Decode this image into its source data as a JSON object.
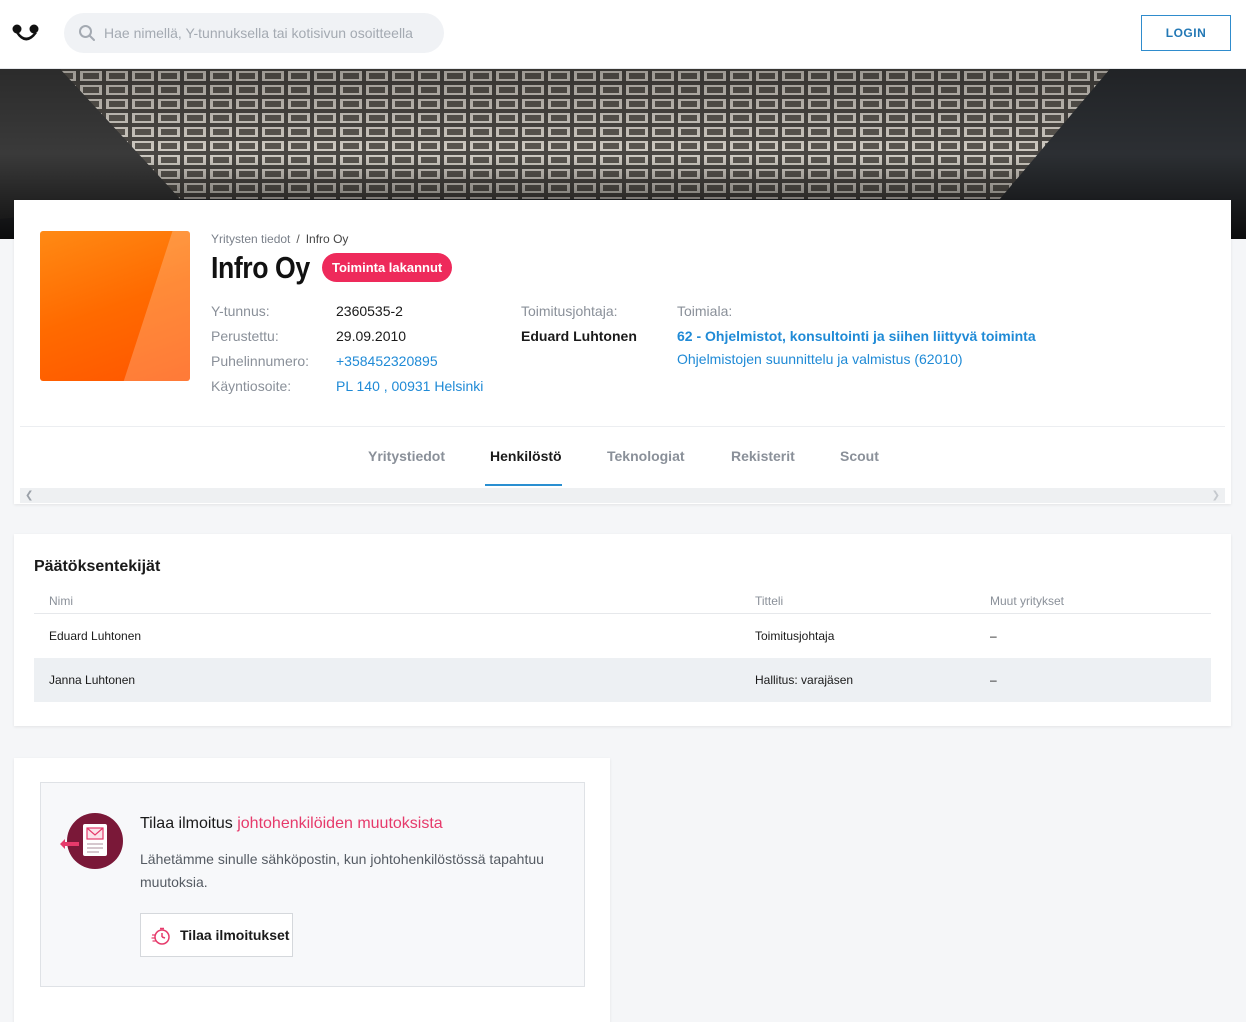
{
  "header": {
    "search_placeholder": "Hae nimellä, Y-tunnuksella tai kotisivun osoitteella",
    "login_label": "LOGIN"
  },
  "company": {
    "breadcrumb_root": "Yritysten tiedot",
    "breadcrumb_sep": "/",
    "breadcrumb_current": "Infro Oy",
    "name": "Infro Oy",
    "status": "Toiminta lakannut",
    "fields": {
      "ytunnus_label": "Y-tunnus:",
      "ytunnus_value": "2360535-2",
      "founded_label": "Perustettu:",
      "founded_value": "29.09.2010",
      "phone_label": "Puhelinnumero:",
      "phone_value": "+358452320895",
      "address_label": "Käyntiosoite:",
      "address_value": "PL 140 , 00931 Helsinki",
      "ceo_label": "Toimitusjohtaja:",
      "ceo_value": "Eduard Luhtonen",
      "industry_label": "Toimiala:",
      "industry_value": "62 - Ohjelmistot, konsultointi ja siihen liittyvä toiminta",
      "industry_sub": "Ohjelmistojen suunnittelu ja valmistus (62010)"
    }
  },
  "tabs": [
    {
      "label": "Yritystiedot"
    },
    {
      "label": "Henkilöstö"
    },
    {
      "label": "Teknologiat"
    },
    {
      "label": "Rekisterit"
    },
    {
      "label": "Scout"
    }
  ],
  "decision_makers": {
    "title": "Päätöksentekijät",
    "columns": [
      "Nimi",
      "Titteli",
      "Muut yritykset"
    ],
    "rows": [
      {
        "name": "Eduard Luhtonen",
        "title": "Toimitusjohtaja",
        "other": "–"
      },
      {
        "name": "Janna Luhtonen",
        "title": "Hallitus: varajäsen",
        "other": "–"
      }
    ]
  },
  "notify": {
    "title_prefix": "Tilaa ilmoitus ",
    "title_accent": "johtohenkilöiden muutoksista",
    "description": "Lähetämme sinulle sähköpostin, kun johtohenkilöstössä tapahtuu muutoksia.",
    "button_label": "Tilaa ilmoitukset"
  },
  "colors": {
    "accent_blue": "#1f8ad6",
    "status_red": "#ee2a5b",
    "notify_accent": "#e63a6b"
  },
  "icons": {
    "logo": "brand-logo-icon",
    "search": "search-icon",
    "notify": "mail-document-icon",
    "button": "stopwatch-icon"
  }
}
